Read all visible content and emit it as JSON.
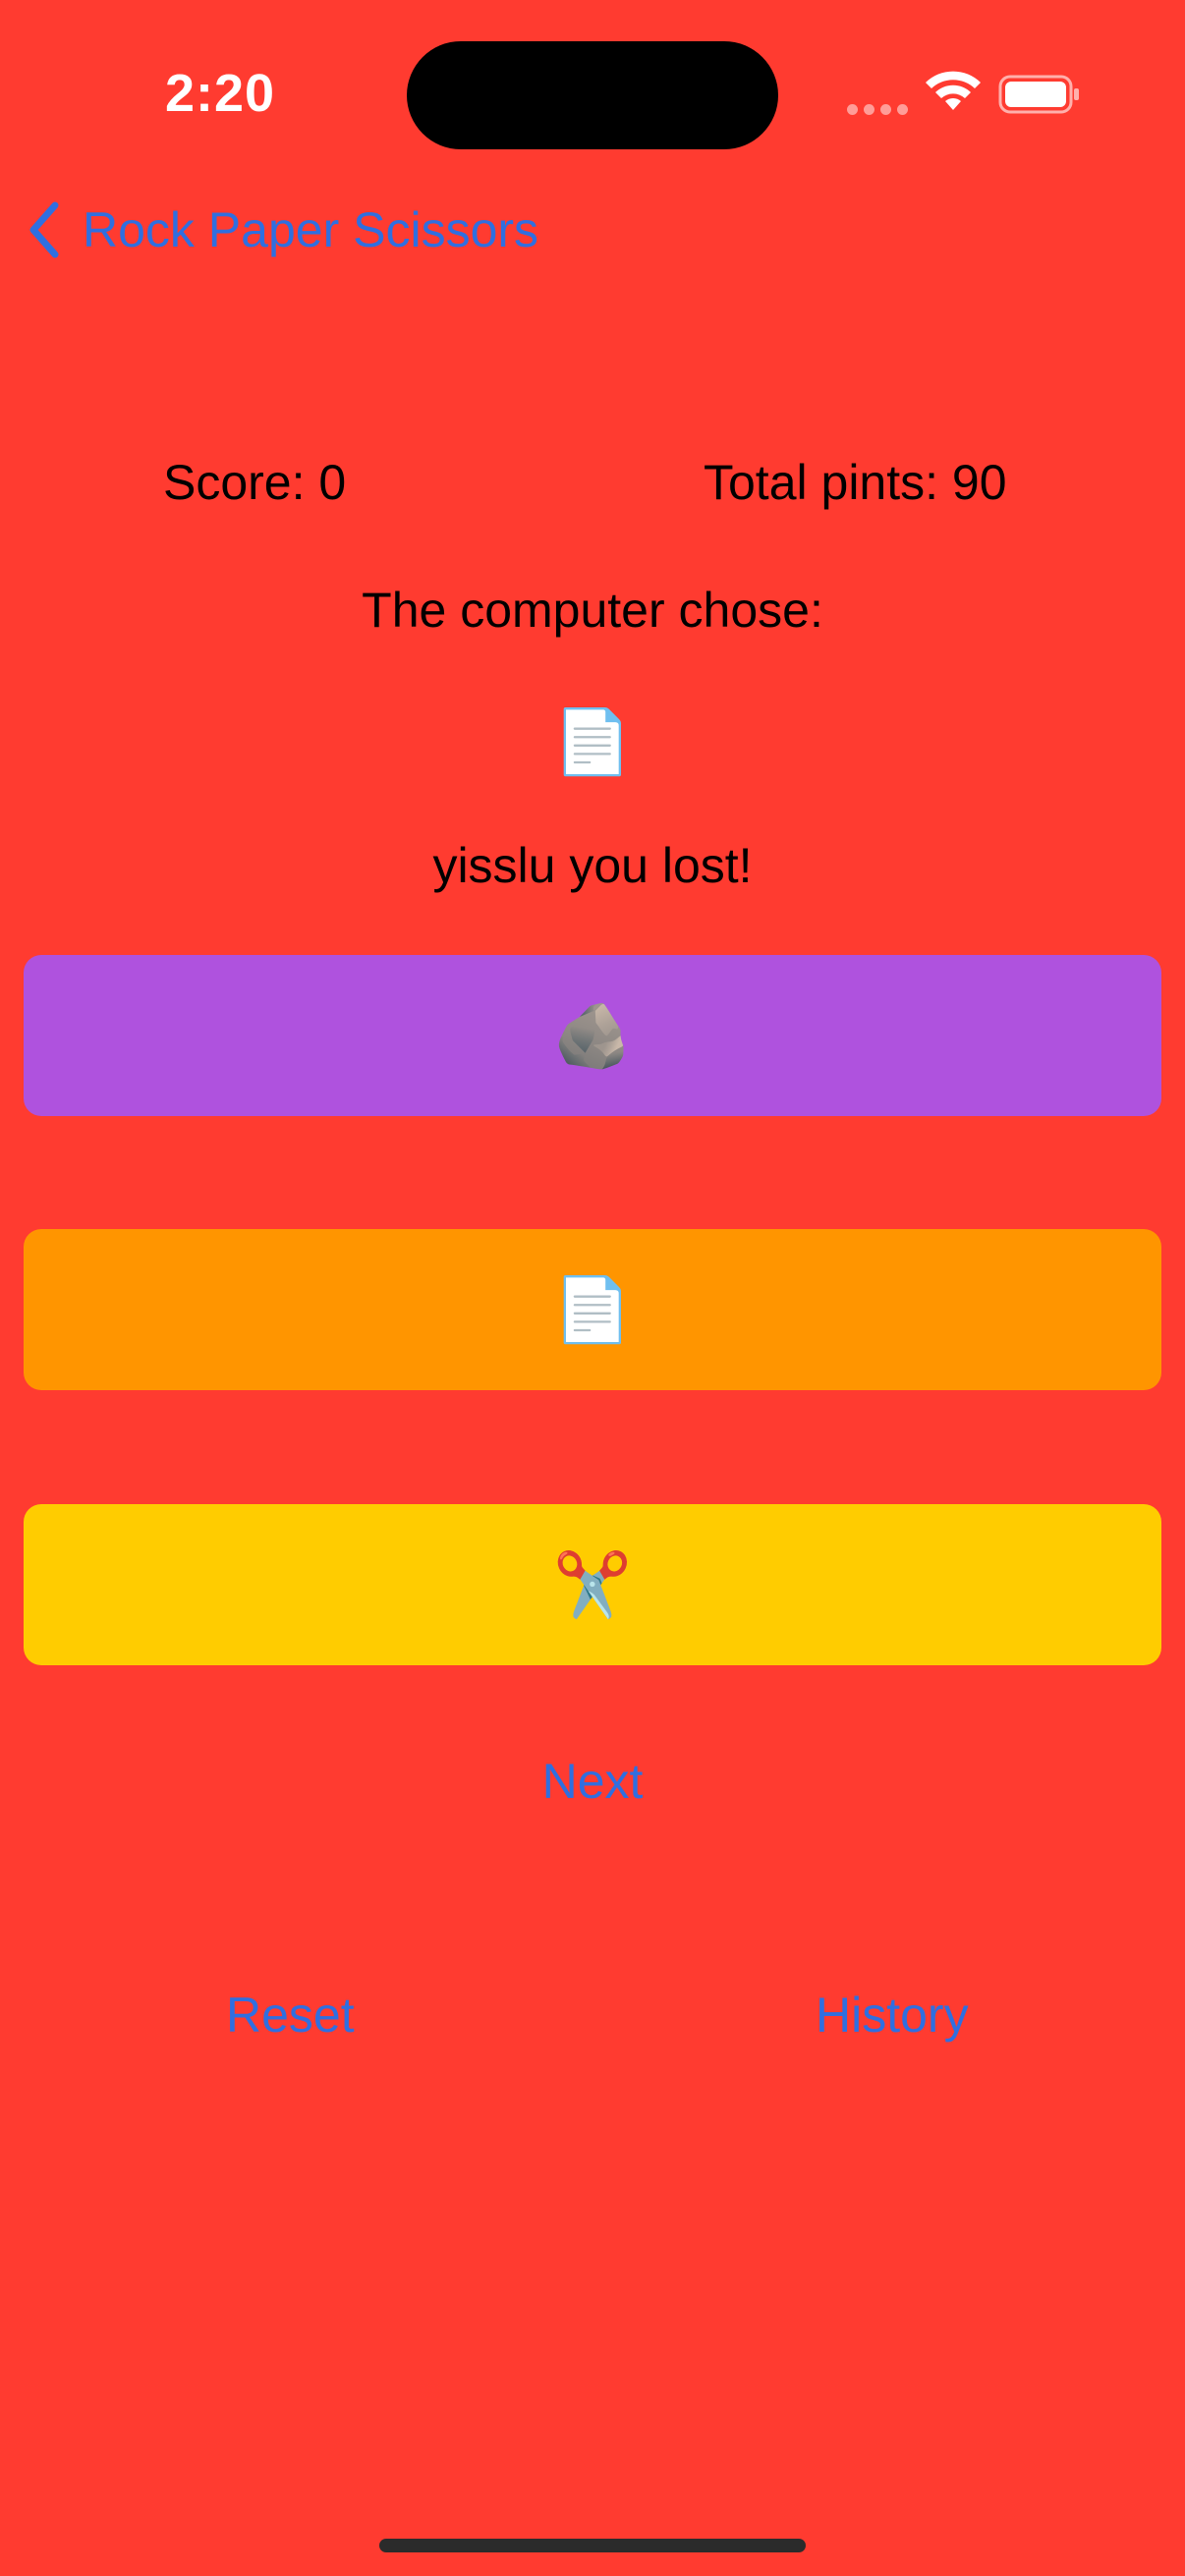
{
  "status_bar": {
    "time": "2:20"
  },
  "nav": {
    "back_label": "Rock Paper Scissors"
  },
  "game": {
    "score_text": "Score: 0",
    "total_text": "Total pints: 90",
    "computer_label": "The computer chose:",
    "computer_choice": "📄",
    "result_text": "yisslu you lost!"
  },
  "choices": {
    "rock": "🪨",
    "paper": "📄",
    "scissors": "✂️"
  },
  "actions": {
    "next": "Next",
    "reset": "Reset",
    "history": "History"
  },
  "colors": {
    "background": "#FF3B30",
    "rock_button": "#AF52DE",
    "paper_button": "#FF9500",
    "scissors_button": "#FFCC00",
    "link": "#2F6FE0"
  }
}
